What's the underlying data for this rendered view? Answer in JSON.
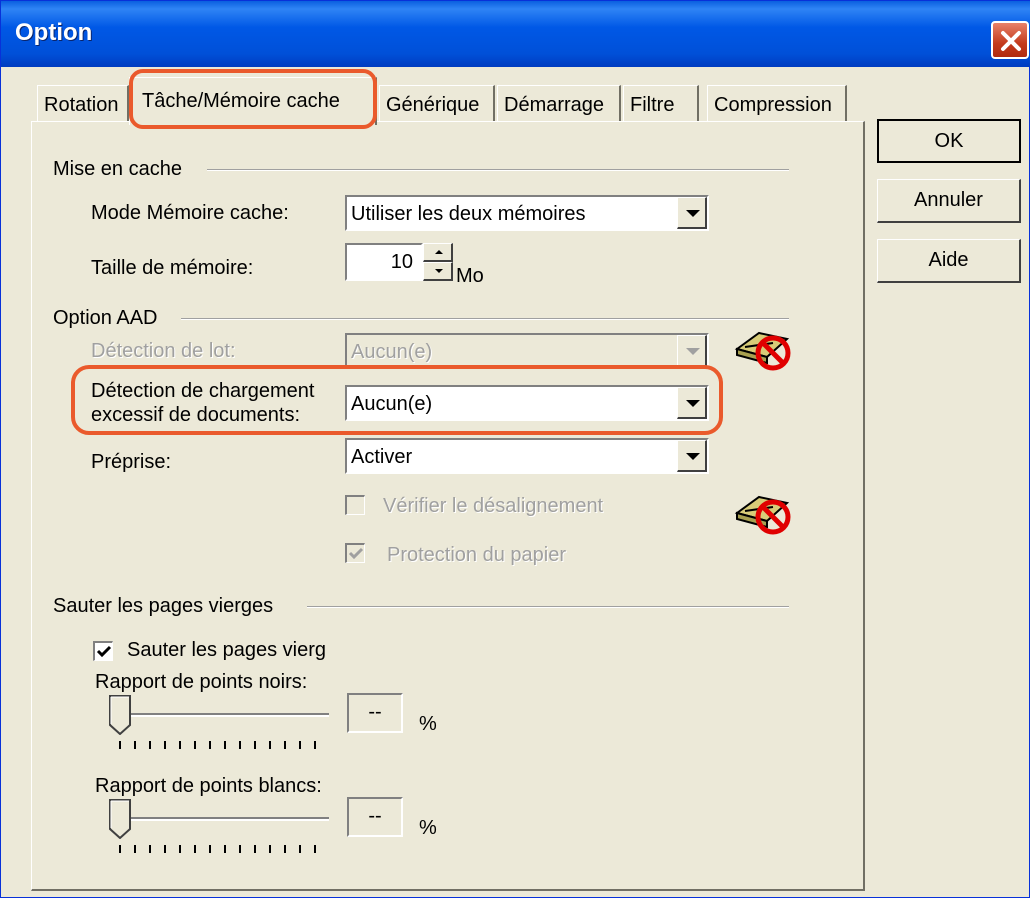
{
  "window": {
    "title": "Option"
  },
  "tabs": [
    {
      "label": "Rotation"
    },
    {
      "label": "Tâche/Mémoire cache",
      "active": true
    },
    {
      "label": "Générique"
    },
    {
      "label": "Démarrage"
    },
    {
      "label": "Filtre"
    },
    {
      "label": "Compression"
    }
  ],
  "caching": {
    "group_label": "Mise en cache",
    "mode_label": "Mode Mémoire cache:",
    "mode_value": "Utiliser les deux mémoires",
    "size_label": "Taille de mémoire:",
    "size_value": "10",
    "size_unit": "Mo"
  },
  "aad": {
    "group_label": "Option AAD",
    "batch_label": "Détection de lot:",
    "batch_value": "Aucun(e)",
    "overload_label_line1": "Détection de chargement",
    "overload_label_line2": "excessif de documents:",
    "overload_value": "Aucun(e)",
    "prepick_label": "Préprise:",
    "prepick_value": "Activer",
    "skew_label": "Vérifier le désalignement",
    "skew_checked": false,
    "paper_label": "Protection du papier",
    "paper_checked": true
  },
  "blank": {
    "group_label": "Sauter les pages vierges",
    "skip_label": "Sauter les pages vierg",
    "skip_checked": true,
    "black_label": "Rapport de points noirs:",
    "black_value": "--",
    "white_label": "Rapport de points blancs:",
    "white_value": "--",
    "percent_sign": "%"
  },
  "buttons": {
    "ok": "OK",
    "cancel": "Annuler",
    "help": "Aide"
  },
  "colors": {
    "highlight": "#ea5a2c",
    "titlebar": "#0058e6",
    "face": "#ece9d8"
  }
}
